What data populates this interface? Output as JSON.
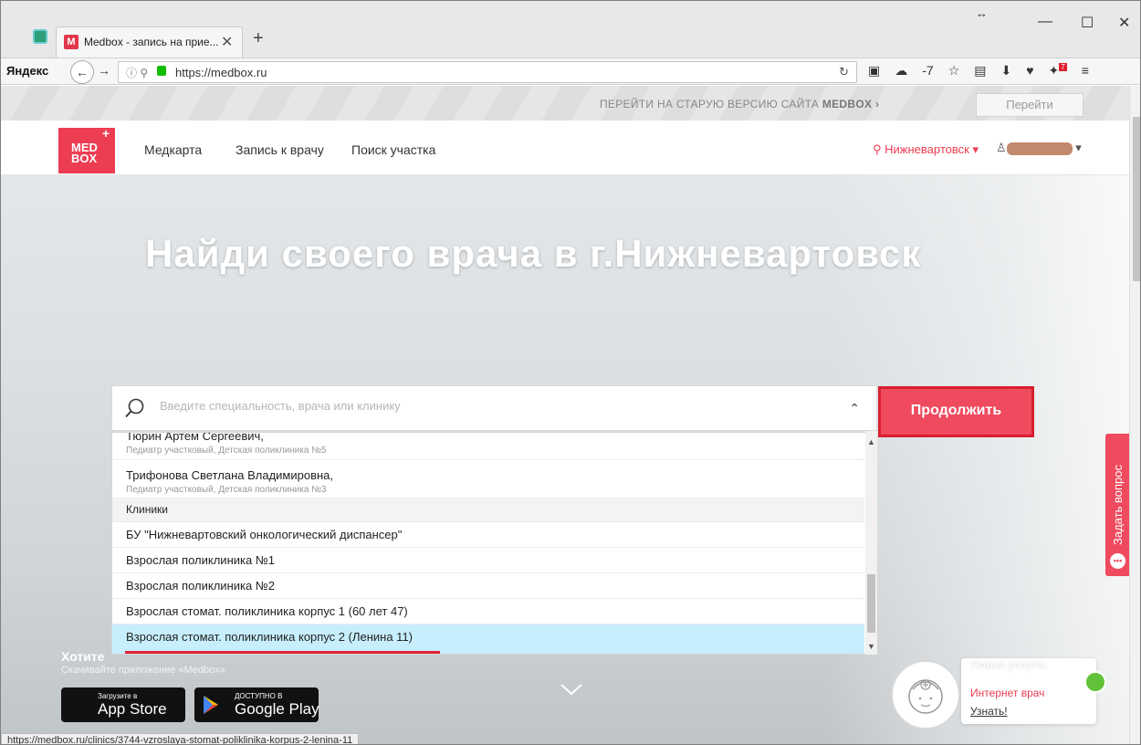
{
  "browser": {
    "tab_title": "Medbox - запись на прие...",
    "tab_favicon": "M",
    "yandex_label": "Яндекс",
    "url": "https://medbox.ru",
    "weather": "-7",
    "notif_badge": "7",
    "status_url": "https://medbox.ru/clinics/3744-vzroslaya-stomat-poliklinika-korpus-2-lenina-11"
  },
  "promo": {
    "text": "ПЕРЕЙТИ НА СТАРУЮ ВЕРСИЮ САЙТА",
    "brand": "MEDBOX",
    "button": "Перейти"
  },
  "header": {
    "logo_line1": "MED",
    "logo_line2": "BOX",
    "nav": [
      "Медкарта",
      "Запись к врачу",
      "Поиск участка"
    ],
    "city": "Нижневартовск"
  },
  "hero": {
    "title": "Найди своего врача в г.Нижневартовск",
    "search_placeholder": "Введите специальность, врача или клинику",
    "submit": "Продолжить",
    "ask_question": "Задать вопрос"
  },
  "dropdown": {
    "doctors": [
      {
        "name": "Тюрин Артем Сергеевич,",
        "sub": "Педиатр участковый, Детская поликлиника №5"
      },
      {
        "name": "Трифонова Светлана Владимировна,",
        "sub": "Педиатр участковый, Детская поликлиника №3"
      }
    ],
    "clinics_header": "Клиники",
    "clinics": [
      "БУ \"Нижневартовский онкологический диспансер\"",
      "Взрослая поликлиника №1",
      "Взрослая поликлиника №2",
      "Взрослая стомат. поликлиника корпус 1 (60 лет 47)",
      "Взрослая стомат. поликлиника корпус 2 (Ленина 11)"
    ]
  },
  "app": {
    "headline": "Хотите",
    "sub": "Скачивайте приложение «Medbox»",
    "appstore_small": "Загрузите в",
    "appstore_big": "App Store",
    "gplay_small": "ДОСТУПНО В",
    "gplay_big": "Google Play"
  },
  "service": {
    "label": "Новая услуга:",
    "name": "Интернет врач",
    "link": "Узнать!"
  },
  "colors": {
    "brand_red": "#ec3d52",
    "selected_row": "#c6eefc",
    "highlight_border": "#d91f2f"
  }
}
